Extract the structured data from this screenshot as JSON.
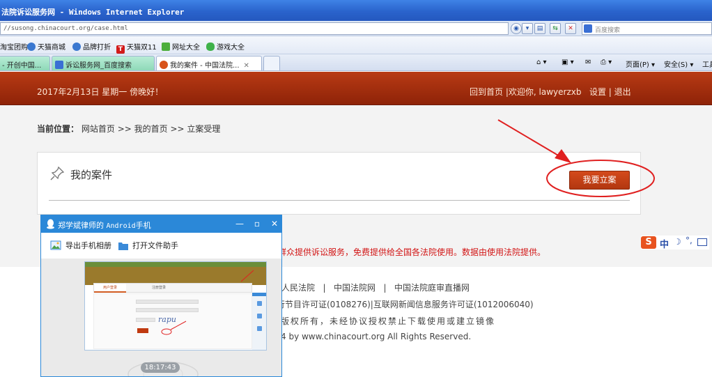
{
  "browser": {
    "title": "法院诉讼服务网 - Windows Internet Explorer",
    "url": "//susong.chinacourt.org/case.html",
    "search_placeholder": "百度搜索",
    "favorites": [
      {
        "label": "淘宝团购"
      },
      {
        "label": "天猫商城"
      },
      {
        "label": "品牌打折"
      },
      {
        "label": "天猫双11"
      },
      {
        "label": "网址大全"
      },
      {
        "label": "游戏大全"
      }
    ],
    "tabs": [
      {
        "label": "- 开创中国..."
      },
      {
        "label": "诉讼服务网_百度搜索"
      },
      {
        "label": "我的案件 - 中国法院..."
      }
    ],
    "commands": {
      "page": "页面(P)",
      "safety": "安全(S)",
      "tools": "工具"
    }
  },
  "header": {
    "date_greeting": "2017年2月13日 星期一 傍晚好！",
    "home_link": "回到首页",
    "welcome": "欢迎你,",
    "username": "lawyerzxb",
    "settings": "设置",
    "logout": "退出",
    "separator": "|"
  },
  "breadcrumb": {
    "label": "当前位置：",
    "items": [
      "网站首页",
      "我的首页",
      "立案受理"
    ],
    "separator": ">>"
  },
  "case_panel": {
    "title": "我的案件",
    "button": "我要立案"
  },
  "notice": "群众提供诉讼服务，免费提供给全国各法院使用。数据由使用法院提供。",
  "footer": {
    "links": [
      "人民法院",
      "中国法院网",
      "中国法院庭审直播网"
    ],
    "link_separator": "|",
    "license": "行节目许可证(0108276)|互联网新闻信息服务许可证(1012006040)",
    "rights": "版权所有，未经协议授权禁止下载使用或建立镜像",
    "copyright": "4 by www.chinacourt.org All Rights Reserved."
  },
  "ime": {
    "mode": "中"
  },
  "phone_window": {
    "title_prefix": "郑学斌律师的",
    "title_device": "Android",
    "title_suffix": "手机",
    "export_photos": "导出手机相册",
    "open_file_helper": "打开文件助手",
    "time": "18:17:43",
    "thumbnail": {
      "tab1": "用户登录",
      "tab2": "注册登录",
      "captcha": "rapu"
    }
  },
  "colors": {
    "header_red": "#a8320f",
    "button_red": "#c4401a",
    "annotation_red": "#e02020",
    "notice_red": "#d21414",
    "qq_blue": "#2b88d8"
  }
}
